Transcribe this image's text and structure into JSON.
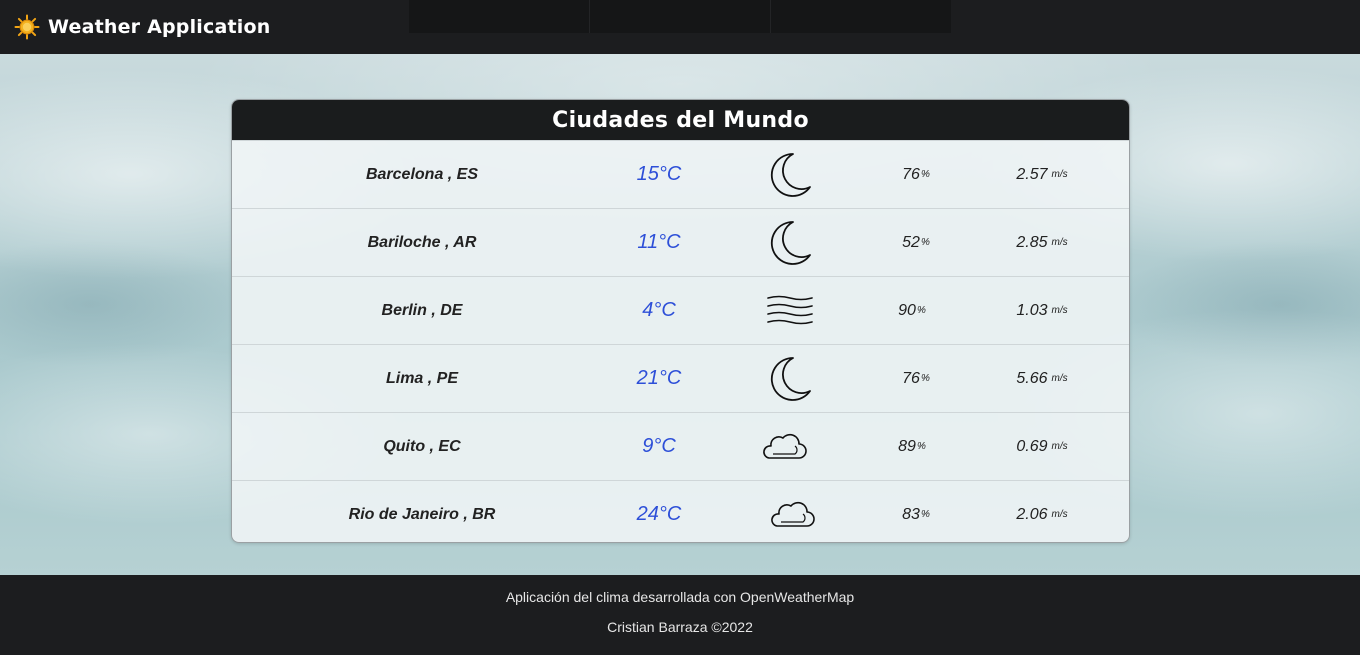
{
  "app": {
    "title": "Weather Application"
  },
  "nav": {
    "items": [
      "",
      "",
      ""
    ]
  },
  "card": {
    "title": "Ciudades del Mundo",
    "rows": [
      {
        "city": "Barcelona , ES",
        "temp": "15°C",
        "icon": "moon-icon",
        "humidity": "76",
        "humidity_unit": "%",
        "wind": "2.57",
        "wind_unit": "m/s"
      },
      {
        "city": "Bariloche , AR",
        "temp": "11°C",
        "icon": "moon-icon",
        "humidity": "52",
        "humidity_unit": "%",
        "wind": "2.85",
        "wind_unit": "m/s"
      },
      {
        "city": "Berlin , DE",
        "temp": "4°C",
        "icon": "fog-icon",
        "humidity": "90",
        "humidity_unit": "%",
        "wind": "1.03",
        "wind_unit": "m/s"
      },
      {
        "city": "Lima , PE",
        "temp": "21°C",
        "icon": "moon-icon",
        "humidity": "76",
        "humidity_unit": "%",
        "wind": "5.66",
        "wind_unit": "m/s"
      },
      {
        "city": "Quito , EC",
        "temp": "9°C",
        "icon": "cloud-icon",
        "humidity": "89",
        "humidity_unit": "%",
        "wind": "0.69",
        "wind_unit": "m/s"
      },
      {
        "city": "Rio de Janeiro , BR",
        "temp": "24°C",
        "icon": "cloud-icon",
        "humidity": "83",
        "humidity_unit": "%",
        "wind": "2.06",
        "wind_unit": "m/s"
      }
    ]
  },
  "footer": {
    "line1": "Aplicación del clima desarrollada con OpenWeatherMap",
    "line2": "Cristian Barraza ©2022"
  },
  "colors": {
    "navbar": "#1c1d1f",
    "temperature": "#2d4fd8",
    "sun": "#f2a516"
  }
}
